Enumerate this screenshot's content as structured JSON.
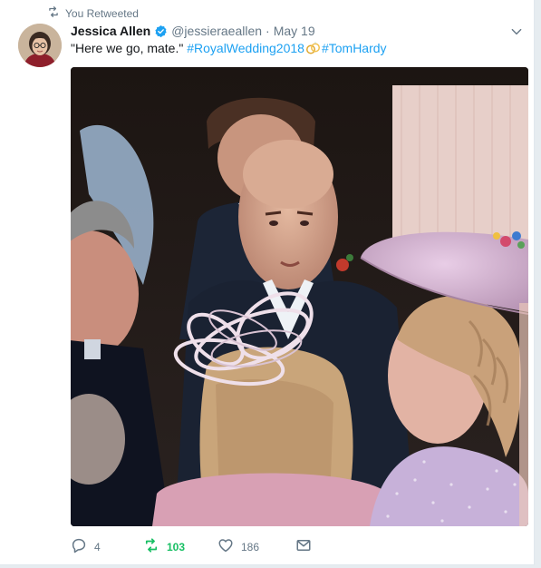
{
  "context": {
    "label": "You Retweeted"
  },
  "author": {
    "name": "Jessica Allen",
    "handle": "@jessieraeallen",
    "separator": "·",
    "date": "May 19",
    "verified": true
  },
  "tweet": {
    "text": "\"Here we go, mate.\" ",
    "hashtags": [
      "#RoyalWedding2018",
      "#TomHardy"
    ],
    "emoji": "wedding-rings"
  },
  "stats": {
    "replies": "4",
    "retweets": "103",
    "likes": "186"
  },
  "colors": {
    "accent": "#1da1f2",
    "retweeted": "#17bf63",
    "muted": "#657786",
    "text": "#14171a"
  },
  "icons": {
    "context": "retweet-icon",
    "verified": "verified-badge-icon",
    "menu": "chevron-down-icon",
    "reply": "reply-icon",
    "retweet": "retweet-icon",
    "like": "heart-icon",
    "dm": "envelope-icon"
  }
}
